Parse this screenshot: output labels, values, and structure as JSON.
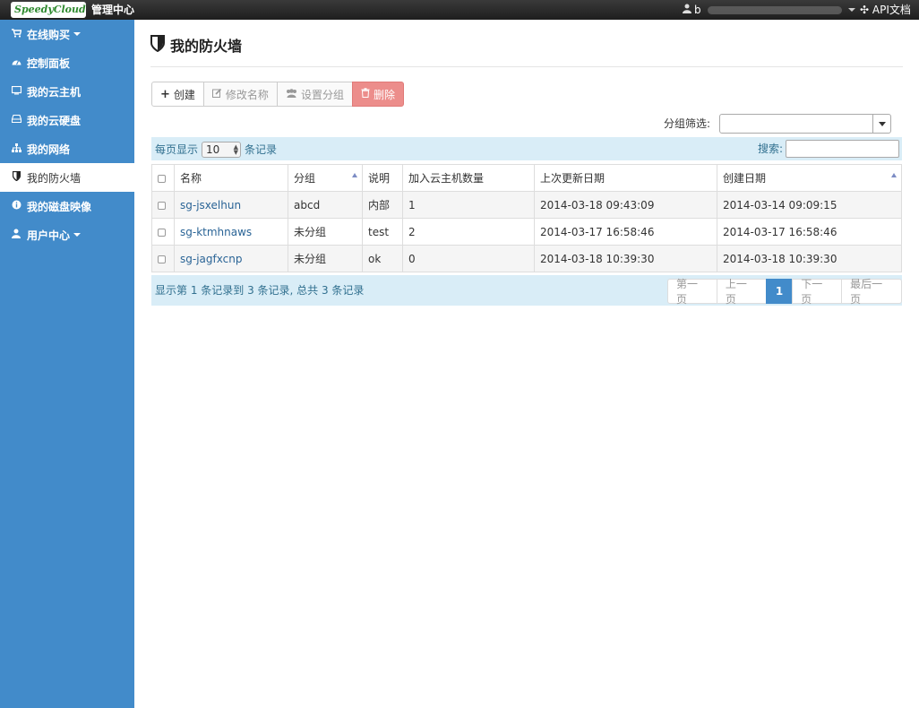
{
  "header": {
    "logo_text": "SpeedyCloud",
    "title": "管理中心",
    "user": "b",
    "api_label": "API文档"
  },
  "sidebar": {
    "items": [
      {
        "label": "在线购买",
        "icon": "cart-icon"
      },
      {
        "label": "控制面板",
        "icon": "dashboard-icon"
      },
      {
        "label": "我的云主机",
        "icon": "monitor-icon"
      },
      {
        "label": "我的云硬盘",
        "icon": "harddisk-icon"
      },
      {
        "label": "我的网络",
        "icon": "sitemap-icon"
      },
      {
        "label": "我的防火墙",
        "icon": "shield-icon"
      },
      {
        "label": "我的磁盘映像",
        "icon": "info-icon"
      },
      {
        "label": "用户中心",
        "icon": "user-icon"
      }
    ]
  },
  "page": {
    "title": "我的防火墙"
  },
  "toolbar": {
    "create": "创建",
    "rename": "修改名称",
    "set_group": "设置分组",
    "delete": "删除"
  },
  "filter": {
    "label": "分组筛选:",
    "value": ""
  },
  "table_controls": {
    "per_page_prefix": "每页显示",
    "per_page_value": "10",
    "per_page_suffix": "条记录",
    "search_label": "搜索:",
    "search_value": ""
  },
  "table": {
    "columns": [
      "名称",
      "分组",
      "说明",
      "加入云主机数量",
      "上次更新日期",
      "创建日期"
    ],
    "rows": [
      {
        "name": "sg-jsxelhun",
        "group": "abcd",
        "desc": "内部",
        "count": "1",
        "updated": "2014-03-18 09:43:09",
        "created": "2014-03-14 09:09:15"
      },
      {
        "name": "sg-ktmhnaws",
        "group": "未分组",
        "desc": "test",
        "count": "2",
        "updated": "2014-03-17 16:58:46",
        "created": "2014-03-17 16:58:46"
      },
      {
        "name": "sg-jagfxcnp",
        "group": "未分组",
        "desc": "ok",
        "count": "0",
        "updated": "2014-03-18 10:39:30",
        "created": "2014-03-18 10:39:30"
      }
    ]
  },
  "footer": {
    "info": "显示第 1 条记录到 3 条记录, 总共 3 条记录",
    "pager": {
      "first": "第一页",
      "prev": "上一页",
      "current": "1",
      "next": "下一页",
      "last": "最后一页"
    }
  },
  "colors": {
    "sidebar": "#428bca",
    "info_bar": "#d9edf7",
    "danger": "#ec8d8b",
    "link": "#2a6496"
  }
}
